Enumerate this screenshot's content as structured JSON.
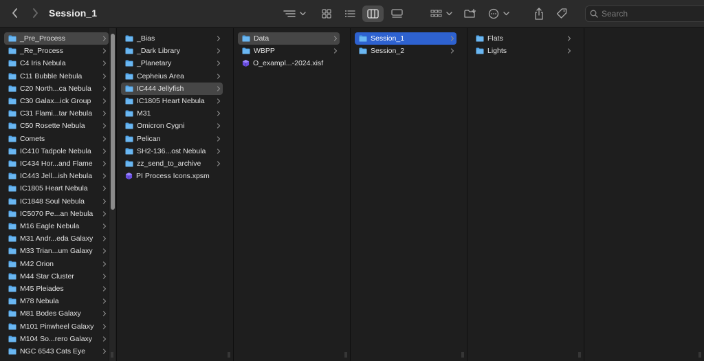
{
  "window": {
    "title": "Session_1"
  },
  "toolbar": {
    "back_icon": "chevron-left-icon",
    "forward_icon": "chevron-right-icon",
    "search_placeholder": "Search"
  },
  "columns": [
    {
      "items": [
        {
          "label": "_Pre_Process",
          "type": "folder",
          "selected": "gray"
        },
        {
          "label": "_Re_Process",
          "type": "folder"
        },
        {
          "label": "C4 Iris Nebula",
          "type": "folder"
        },
        {
          "label": "C11 Bubble Nebula",
          "type": "folder"
        },
        {
          "label": "C20 North...ca Nebula",
          "type": "folder"
        },
        {
          "label": "C30 Galax...ick Group",
          "type": "folder"
        },
        {
          "label": "C31 Flami...tar Nebula",
          "type": "folder"
        },
        {
          "label": "C50 Rosette Nebula",
          "type": "folder"
        },
        {
          "label": "Comets",
          "type": "folder"
        },
        {
          "label": "IC410 Tadpole Nebula",
          "type": "folder"
        },
        {
          "label": "IC434 Hor...and Flame",
          "type": "folder"
        },
        {
          "label": "IC443 Jell...ish Nebula",
          "type": "folder"
        },
        {
          "label": "IC1805 Heart Nebula",
          "type": "folder"
        },
        {
          "label": "IC1848 Soul Nebula",
          "type": "folder"
        },
        {
          "label": "IC5070 Pe...an Nebula",
          "type": "folder"
        },
        {
          "label": "M16 Eagle Nebula",
          "type": "folder"
        },
        {
          "label": "M31 Andr...eda Galaxy",
          "type": "folder"
        },
        {
          "label": "M33 Trian...um Galaxy",
          "type": "folder"
        },
        {
          "label": "M42 Orion",
          "type": "folder"
        },
        {
          "label": "M44 Star Cluster",
          "type": "folder"
        },
        {
          "label": "M45 Pleiades",
          "type": "folder"
        },
        {
          "label": "M78 Nebula",
          "type": "folder"
        },
        {
          "label": "M81 Bodes Galaxy",
          "type": "folder"
        },
        {
          "label": "M101 Pinwheel Galaxy",
          "type": "folder"
        },
        {
          "label": "M104 So...rero Galaxy",
          "type": "folder"
        },
        {
          "label": "NGC 6543 Cats Eye",
          "type": "folder"
        }
      ]
    },
    {
      "items": [
        {
          "label": "_Bias",
          "type": "folder"
        },
        {
          "label": "_Dark Library",
          "type": "folder"
        },
        {
          "label": "_Planetary",
          "type": "folder"
        },
        {
          "label": "Cepheius Area",
          "type": "folder"
        },
        {
          "label": "IC444 Jellyfish",
          "type": "folder",
          "selected": "gray"
        },
        {
          "label": "IC1805 Heart Nebula",
          "type": "folder"
        },
        {
          "label": "M31",
          "type": "folder"
        },
        {
          "label": "Omicron Cygni",
          "type": "folder"
        },
        {
          "label": "Pelican",
          "type": "folder"
        },
        {
          "label": "SH2-136...ost Nebula",
          "type": "folder"
        },
        {
          "label": "zz_send_to_archive",
          "type": "folder"
        },
        {
          "label": "PI Process Icons.xpsm",
          "type": "file"
        }
      ]
    },
    {
      "items": [
        {
          "label": "Data",
          "type": "folder",
          "selected": "gray"
        },
        {
          "label": "WBPP",
          "type": "folder"
        },
        {
          "label": "O_exampl...-2024.xisf",
          "type": "file"
        }
      ]
    },
    {
      "items": [
        {
          "label": "Session_1",
          "type": "folder",
          "selected": "blue"
        },
        {
          "label": "Session_2",
          "type": "folder"
        }
      ]
    },
    {
      "items": [
        {
          "label": "Flats",
          "type": "folder"
        },
        {
          "label": "Lights",
          "type": "folder"
        }
      ]
    },
    {
      "items": []
    }
  ],
  "colors": {
    "folder": "#4fa3e8",
    "selection_blue": "#2e62d0",
    "selection_gray": "#464646",
    "file_icon": "#6a4fe0"
  }
}
